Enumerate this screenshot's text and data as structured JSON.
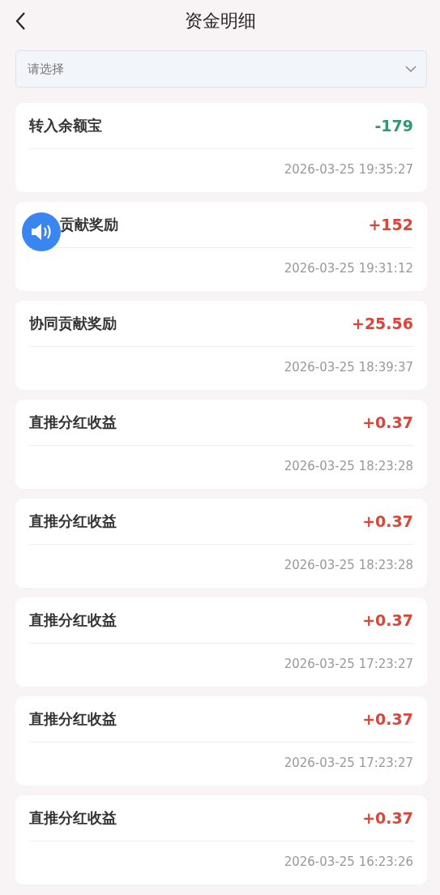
{
  "header": {
    "title": "资金明细"
  },
  "filter": {
    "placeholder": "请选择"
  },
  "records": [
    {
      "title": "转入余额宝",
      "amount": "-179",
      "color": "#2e9a6e",
      "time": "2026-03-25 19:35:27"
    },
    {
      "title": "贡献奖励",
      "amount": "+152",
      "color": "#d9473b",
      "time": "2026-03-25 19:31:12"
    },
    {
      "title": "协同贡献奖励",
      "amount": "+25.56",
      "color": "#d9473b",
      "time": "2026-03-25 18:39:37"
    },
    {
      "title": "直推分红收益",
      "amount": "+0.37",
      "color": "#d9473b",
      "time": "2026-03-25 18:23:28"
    },
    {
      "title": "直推分红收益",
      "amount": "+0.37",
      "color": "#d9473b",
      "time": "2026-03-25 18:23:28"
    },
    {
      "title": "直推分红收益",
      "amount": "+0.37",
      "color": "#d9473b",
      "time": "2026-03-25 17:23:27"
    },
    {
      "title": "直推分红收益",
      "amount": "+0.37",
      "color": "#d9473b",
      "time": "2026-03-25 17:23:27"
    },
    {
      "title": "直推分红收益",
      "amount": "+0.37",
      "color": "#d9473b",
      "time": "2026-03-25 16:23:26"
    }
  ]
}
